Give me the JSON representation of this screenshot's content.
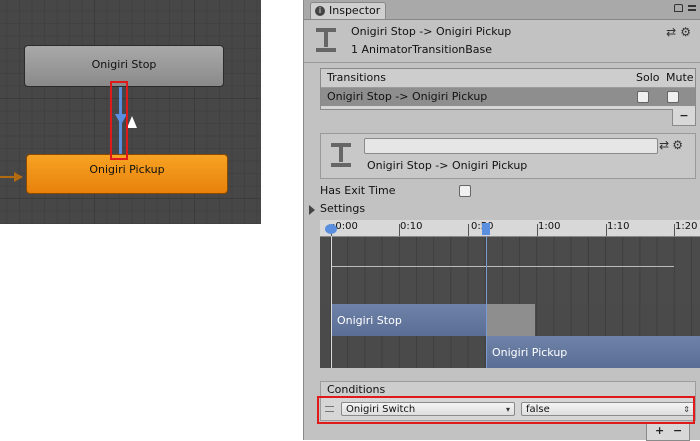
{
  "graph": {
    "state_stop": "Onigiri Stop",
    "state_pickup": "Onigiri Pickup"
  },
  "inspector": {
    "tab_title": "Inspector",
    "header_title": "Onigiri Stop -> Onigiri Pickup",
    "header_subtitle": "1 AnimatorTransitionBase",
    "transitions": {
      "header": "Transitions",
      "col_solo": "Solo",
      "col_mute": "Mute",
      "row_label": "Onigiri Stop -> Onigiri Pickup",
      "remove_label": "−"
    },
    "selected": {
      "name_field_value": "",
      "name": "Onigiri Stop -> Onigiri Pickup"
    },
    "has_exit_time_label": "Has Exit Time",
    "has_exit_time_checked": false,
    "settings_label": "Settings",
    "timeline": {
      "ticks": [
        ":0:00",
        "0:10",
        "0:50",
        "1:00",
        "1:10",
        "1:20"
      ],
      "clip_stop": "Onigiri Stop",
      "clip_pickup": "Onigiri Pickup"
    },
    "conditions": {
      "header": "Conditions",
      "parameter": "Onigiri Switch",
      "value": "false",
      "add_label": "+",
      "remove_label": "−"
    }
  },
  "colors": {
    "transition_blue": "#5a8fe0",
    "pickup_orange": "#f39520",
    "highlight_red": "#e01a1a"
  }
}
